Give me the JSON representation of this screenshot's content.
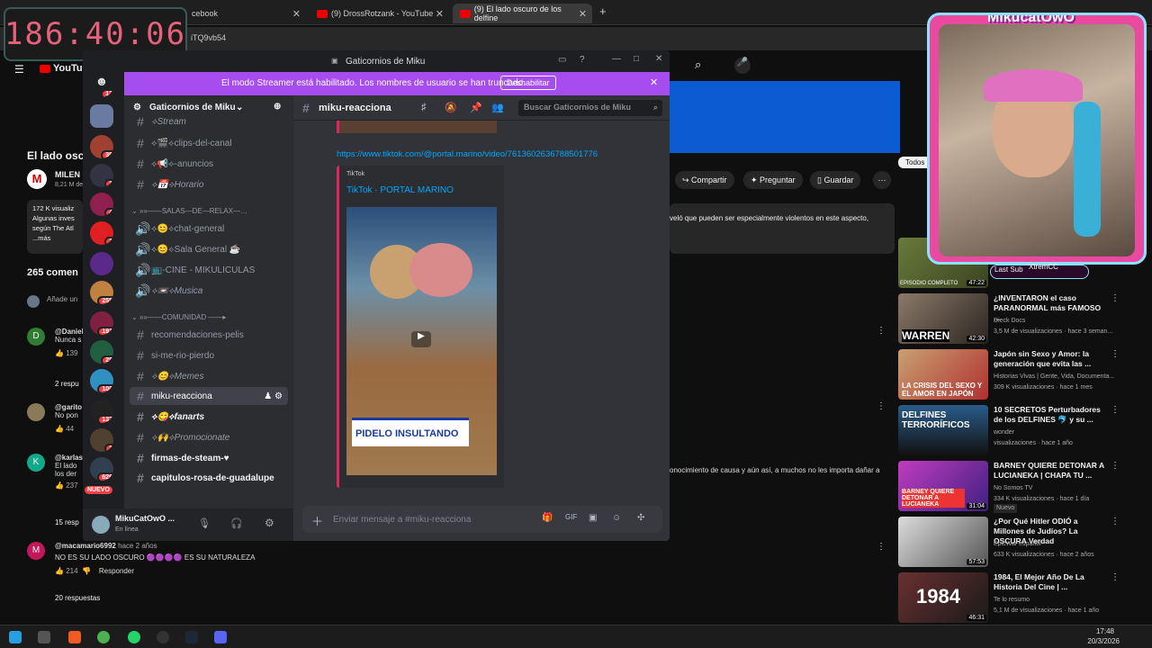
{
  "timer": "186:40:06",
  "browser_tabs": [
    {
      "label": "cebook"
    },
    {
      "label": "(9) DrossRotzank - YouTube"
    },
    {
      "label": "(9) El lado oscuro de los delfine"
    }
  ],
  "address": "iTQ9vb54",
  "discord": {
    "window_title": "Gaticornios de Miku",
    "banner_text": "El modo Streamer está habilitado. Los nombres de usuario se han truncado.",
    "banner_button": "Deshabilitar",
    "server_name": "Gaticornios de Miku",
    "server_badges": [
      "13",
      "39",
      "1",
      "4",
      "1",
      "255",
      "191",
      "25",
      "100",
      "137",
      "1",
      "626",
      "NUEVO"
    ],
    "channels": [
      {
        "name": "⟡Stream"
      },
      {
        "name": "⟡🎬⟡clips-del-canal"
      },
      {
        "name": "⟡📢⟡-anuncios"
      },
      {
        "name": "⟡📅⟡Horario"
      }
    ],
    "cat_salas": "»»——SALAS—DE—RELAX—…",
    "voice_channels": [
      {
        "name": "⟡😊⟡chat-general"
      },
      {
        "name": "⟡😊⟡Sala General ☕"
      },
      {
        "name": "📺-CINE - MIKULICULAS"
      },
      {
        "name": "⟡📼⟡Musica"
      }
    ],
    "cat_comunidad": "»»——COMUNIDAD ——▸",
    "community_channels": [
      {
        "name": "recomendaciones-pelis"
      },
      {
        "name": "si-me-rio-pierdo"
      },
      {
        "name": "⟡😊⟡Memes"
      },
      {
        "name": "miku-reacciona"
      },
      {
        "name": "⟡😋⟡fanarts"
      },
      {
        "name": "⟡🙌⟡Promocionate"
      },
      {
        "name": "firmas-de-steam-♥"
      },
      {
        "name": "capitulos-rosa-de-guadalupe"
      }
    ],
    "user": {
      "name": "MikuCatOwO ...",
      "status": "En línea"
    },
    "chat_channel": "miku-reacciona",
    "search_placeholder": "Buscar Gaticornios de Miku",
    "link": "https://www.tiktok.com/@portal.marino/video/7613602636788501776",
    "embed_provider": "TikTok",
    "embed_title": "TikTok · PORTAL MARINO",
    "embed_caption": "PIDELO INSULTANDO",
    "composer_placeholder": "Enviar mensaje a #miku-reacciona"
  },
  "youtube_left": {
    "logo": "YouTube",
    "video_title": "El lado osc",
    "channel": "MILEN",
    "subs": "8,21 M de",
    "desc_lines": [
      "172 K visualiz",
      "Algunas inves",
      "según The Atl",
      "...más"
    ],
    "comments_count": "265 comen",
    "add_comment": "Añade un",
    "comments": [
      {
        "author": "@Daniel",
        "text": "Nunca s",
        "likes": "139"
      },
      {
        "replies": "2 respu"
      },
      {
        "author": "@garito",
        "text": "No pon",
        "likes": "44"
      },
      {
        "author": "@karlas",
        "text": "El lado",
        "text2": "los der",
        "likes": "237"
      },
      {
        "replies": "15 resp"
      },
      {
        "author": "@macamario6992",
        "time": "hace 2 años",
        "text": "NO ES SU LADO OSCURO 🟣🟣🟣🟣 ES SU NATURALEZA",
        "likes": "214",
        "reply": "Responder"
      },
      {
        "replies": "20 respuestas"
      }
    ]
  },
  "youtube_right": {
    "actions": [
      "Compartir",
      "Preguntar",
      "Guardar"
    ],
    "filter": "Todos",
    "desc_snippet": "veló que pueden ser especialmente violentos en este aspecto,",
    "desc_snippet2": "onocimiento de causa y aún así, a muchos no les importa dañar a",
    "videos": [
      {
        "title": "",
        "channel": "",
        "meta": "",
        "duration": "47:22",
        "thumb_text": "EPISODIO COMPLETO"
      },
      {
        "title": "¿INVENTARON el caso PARANORMAL más FAMOSO ...",
        "channel": "Dieck Docs",
        "meta": "3,5 M de visualizaciones · hace 3 seman...",
        "duration": "42:30",
        "thumb_text": "WARREN"
      },
      {
        "title": "Japón sin Sexo y Amor: la generación que evita las ...",
        "channel": "Historias Vivas | Gente, Vida, Documenta...",
        "meta": "309 K visualizaciones · hace 1 mes",
        "duration": "",
        "thumb_text": "LA CRISIS DEL SEXO Y EL AMOR EN JAPÓN"
      },
      {
        "title": "10 SECRETOS Perturbadores de los DELFINES 🐬 y su ...",
        "channel": "wonder",
        "meta": "visualizaciones · hace 1 año",
        "duration": "",
        "thumb_text": "DELFINES TERRORÍFICOS"
      },
      {
        "title": "BARNEY QUIERE DETONAR A LUCIANEKA | CHAPA TU ...",
        "channel": "No Somos TV",
        "meta": "334 K visualizaciones · hace 1 día",
        "badge": "Nuevo",
        "duration": "31:04",
        "thumb_text": "BARNEY QUIERE DETONAR A LUCIANEKA"
      },
      {
        "title": "¿Por Qué Hitler ODIÓ a Millones de Judíos? La OSCURA Verdad",
        "channel": "EpicWar español",
        "meta": "633 K visualizaciones · hace 2 años",
        "duration": "57:53",
        "thumb_text": ""
      },
      {
        "title": "1984, El Mejor Año De La Historia Del Cine | ...",
        "channel": "Te lo resumo",
        "meta": "5,1 M de visualizaciones · hace 1 año",
        "duration": "46:31",
        "thumb_text": "1984"
      }
    ]
  },
  "webcam": {
    "name": "MikucatOwO",
    "last_sub_label": "Last Sub",
    "last_sub_name": "XtremCC"
  },
  "taskbar": {
    "time": "17:48",
    "date": "20/3/2026"
  }
}
